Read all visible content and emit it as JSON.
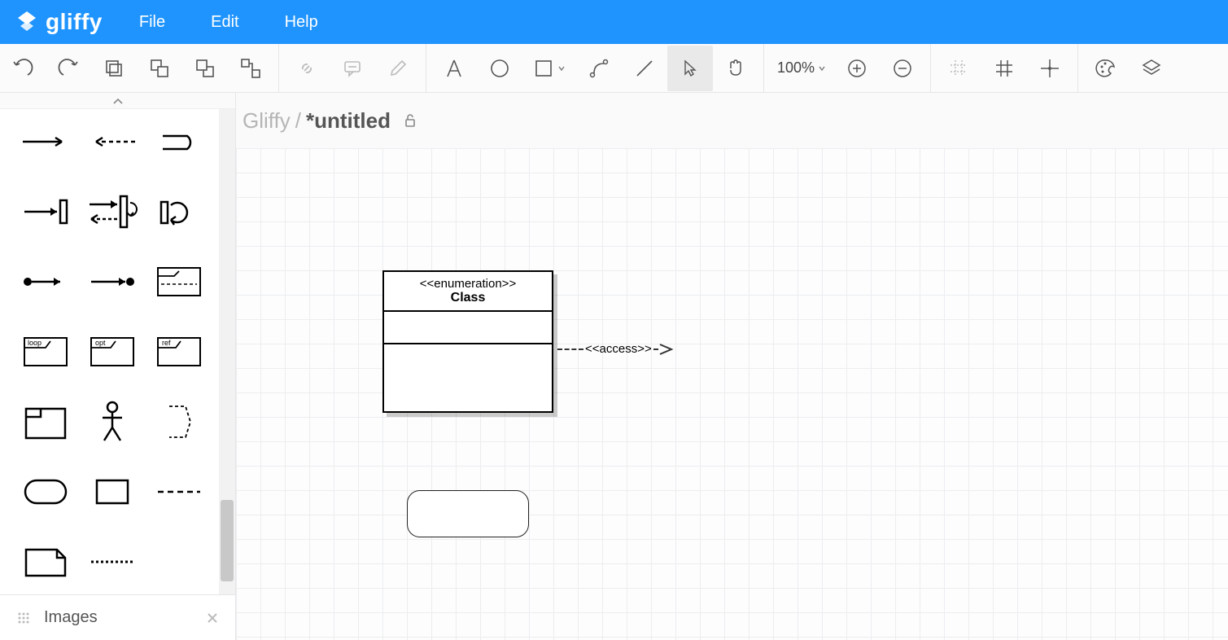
{
  "app": {
    "name": "gliffy"
  },
  "menu": {
    "file": "File",
    "edit": "Edit",
    "help": "Help"
  },
  "toolbar": {
    "zoom": "100%"
  },
  "breadcrumb": {
    "app": "Gliffy",
    "sep": "/",
    "doc": "*untitled"
  },
  "sidebar": {
    "images_label": "Images"
  },
  "canvas": {
    "uml_class": {
      "stereotype": "<<enumeration>>",
      "name": "Class"
    },
    "connector": {
      "label": "<<access>>"
    }
  }
}
